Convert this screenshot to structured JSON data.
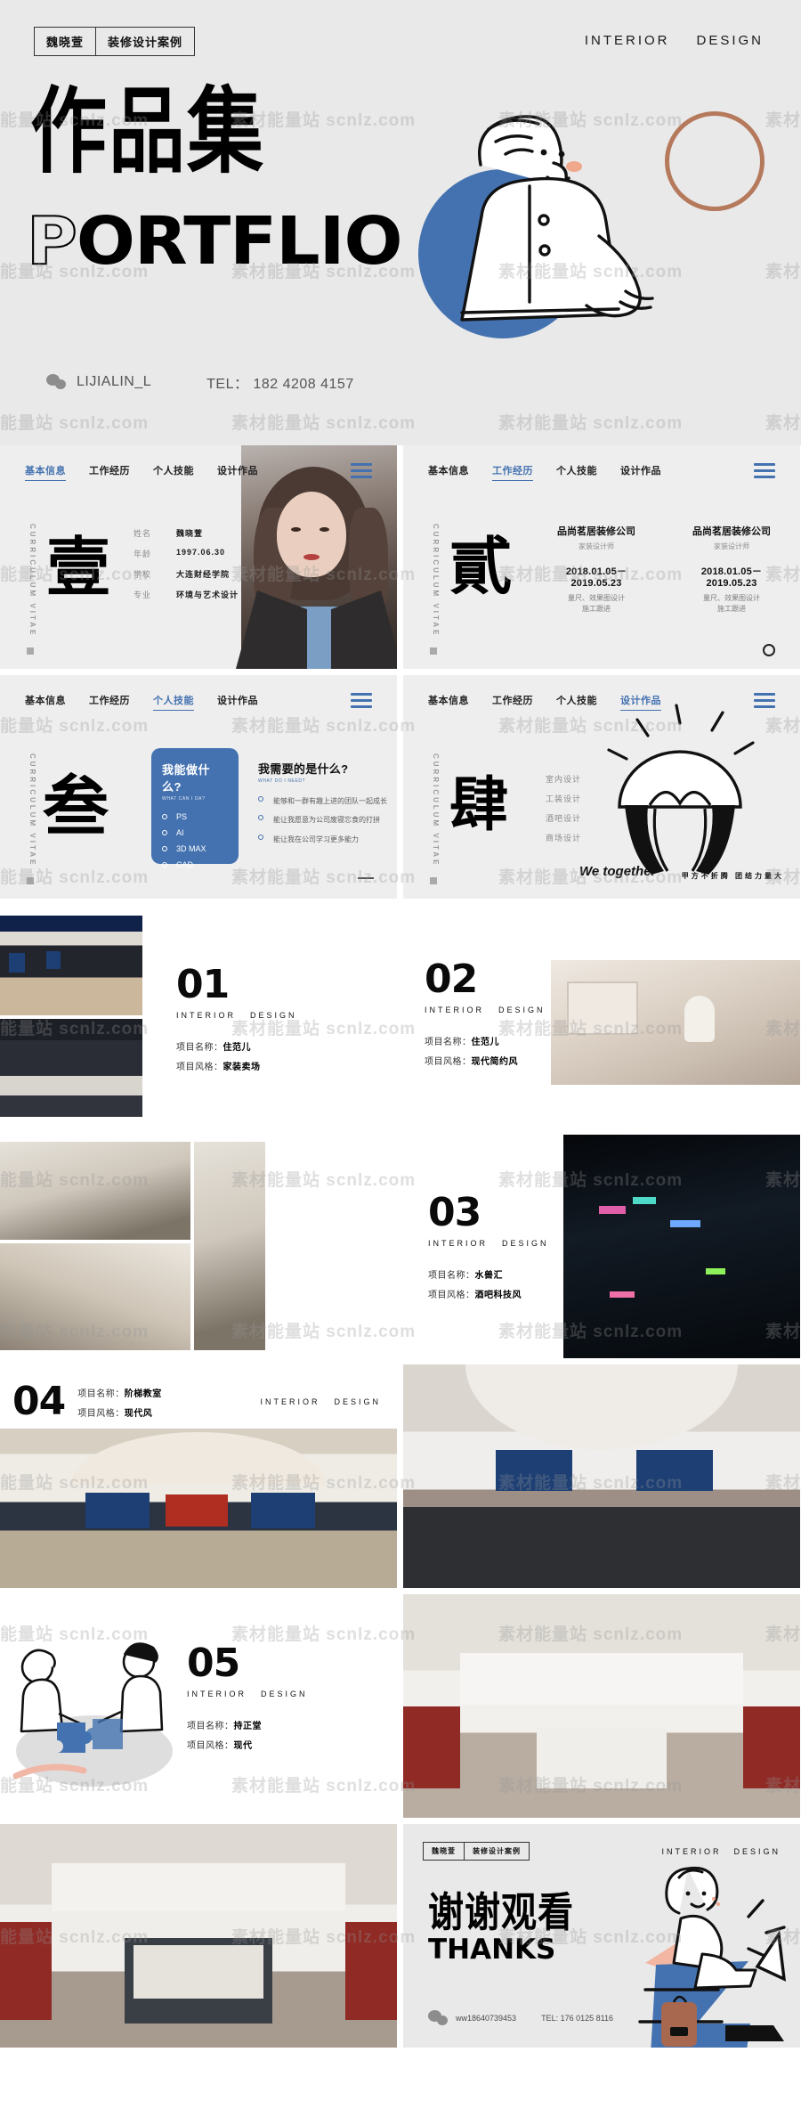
{
  "hero": {
    "badge_name": "魏晓萱",
    "badge_label": "装修设计案例",
    "id_left": "INTERIOR",
    "id_right": "DESIGN",
    "title_cn": "作品集",
    "title_en_first": "P",
    "title_en_rest": "ORTFLIO",
    "wechat_id": "LIJIALIN_L",
    "tel": "TEL： 182 4208 4157",
    "blue": "#4472b0",
    "ring": "#b5795c"
  },
  "nav": {
    "items": [
      "基本信息",
      "工作经历",
      "个人技能",
      "设计作品"
    ]
  },
  "vertical_label": "CURRICULUM  VITAE",
  "slides": {
    "basic_info": {
      "kanji": "壹",
      "active_tab": "基本信息",
      "rows": [
        {
          "key": "姓名",
          "value": "魏晓萱"
        },
        {
          "key": "年龄",
          "value": "1997.06.30"
        },
        {
          "key": "学校",
          "value": "大连财经学院"
        },
        {
          "key": "专业",
          "value": "环境与艺术设计"
        }
      ]
    },
    "work": {
      "kanji": "貳",
      "active_tab": "工作经历",
      "columns": [
        {
          "company": "品尚茗居装修公司",
          "role": "家装设计师",
          "date": "2018.01.05－2019.05.23",
          "desc1": "量尺、效果图设计",
          "desc2": "施工跟进"
        },
        {
          "company": "品尚茗居装修公司",
          "role": "家装设计师",
          "date": "2018.01.05－2019.05.23",
          "desc1": "量尺、效果图设计",
          "desc2": "施工跟进"
        }
      ]
    },
    "skills": {
      "kanji": "叁",
      "active_tab": "个人技能",
      "can_title": "我能做什么?",
      "can_subtitle": "WHAT CAN I DA?",
      "can_items": [
        "PS",
        "AI",
        "3D MAX",
        "CAD"
      ],
      "need_title": "我需要的是什么?",
      "need_subtitle": "WHAT DO I NEED?",
      "need_items": [
        "能够和一群有趣上进的团队一起成长",
        "能让我愿意为公司废寝忘食的打拼",
        "能让我在公司学习更多能力"
      ]
    },
    "works": {
      "kanji": "肆",
      "active_tab": "设计作品",
      "list": [
        "室内设计",
        "工装设计",
        "酒吧设计",
        "商场设计"
      ],
      "handwritten": "We together",
      "vertical_quote": "甲方不折腾 团结力量大"
    }
  },
  "projects": [
    {
      "number": "01",
      "label_left": "INTERIOR",
      "label_right": "DESIGN",
      "name_key": "项目名称：",
      "name_value": "住范儿",
      "style_key": "项目风格：",
      "style_value": "家装卖场"
    },
    {
      "number": "02",
      "label_left": "INTERIOR",
      "label_right": "DESIGN",
      "name_key": "项目名称：",
      "name_value": "住范儿",
      "style_key": "项目风格：",
      "style_value": "现代简约风"
    },
    {
      "number": "03",
      "label_left": "INTERIOR",
      "label_right": "DESIGN",
      "name_key": "项目名称：",
      "name_value": "水兽汇",
      "style_key": "项目风格：",
      "style_value": "酒吧科技风"
    },
    {
      "number": "04",
      "label_left": "INTERIOR",
      "label_right": "DESIGN",
      "name_key": "项目名称：",
      "name_value": "阶梯教室",
      "style_key": "项目风格：",
      "style_value": "现代风"
    },
    {
      "number": "05",
      "label_left": "INTERIOR",
      "label_right": "DESIGN",
      "name_key": "项目名称：",
      "name_value": "持正堂",
      "style_key": "项目风格：",
      "style_value": "现代"
    }
  ],
  "thanks": {
    "badge_name": "魏晓萱",
    "badge_label": "装修设计案例",
    "id_left": "INTERIOR",
    "id_right": "DESIGN",
    "title_cn": "谢谢观看",
    "title_en": "THANKS",
    "wechat": "ww18640739453",
    "tel": "TEL: 176 0125 8116"
  },
  "watermark": "素材能量站 scnlz.com"
}
